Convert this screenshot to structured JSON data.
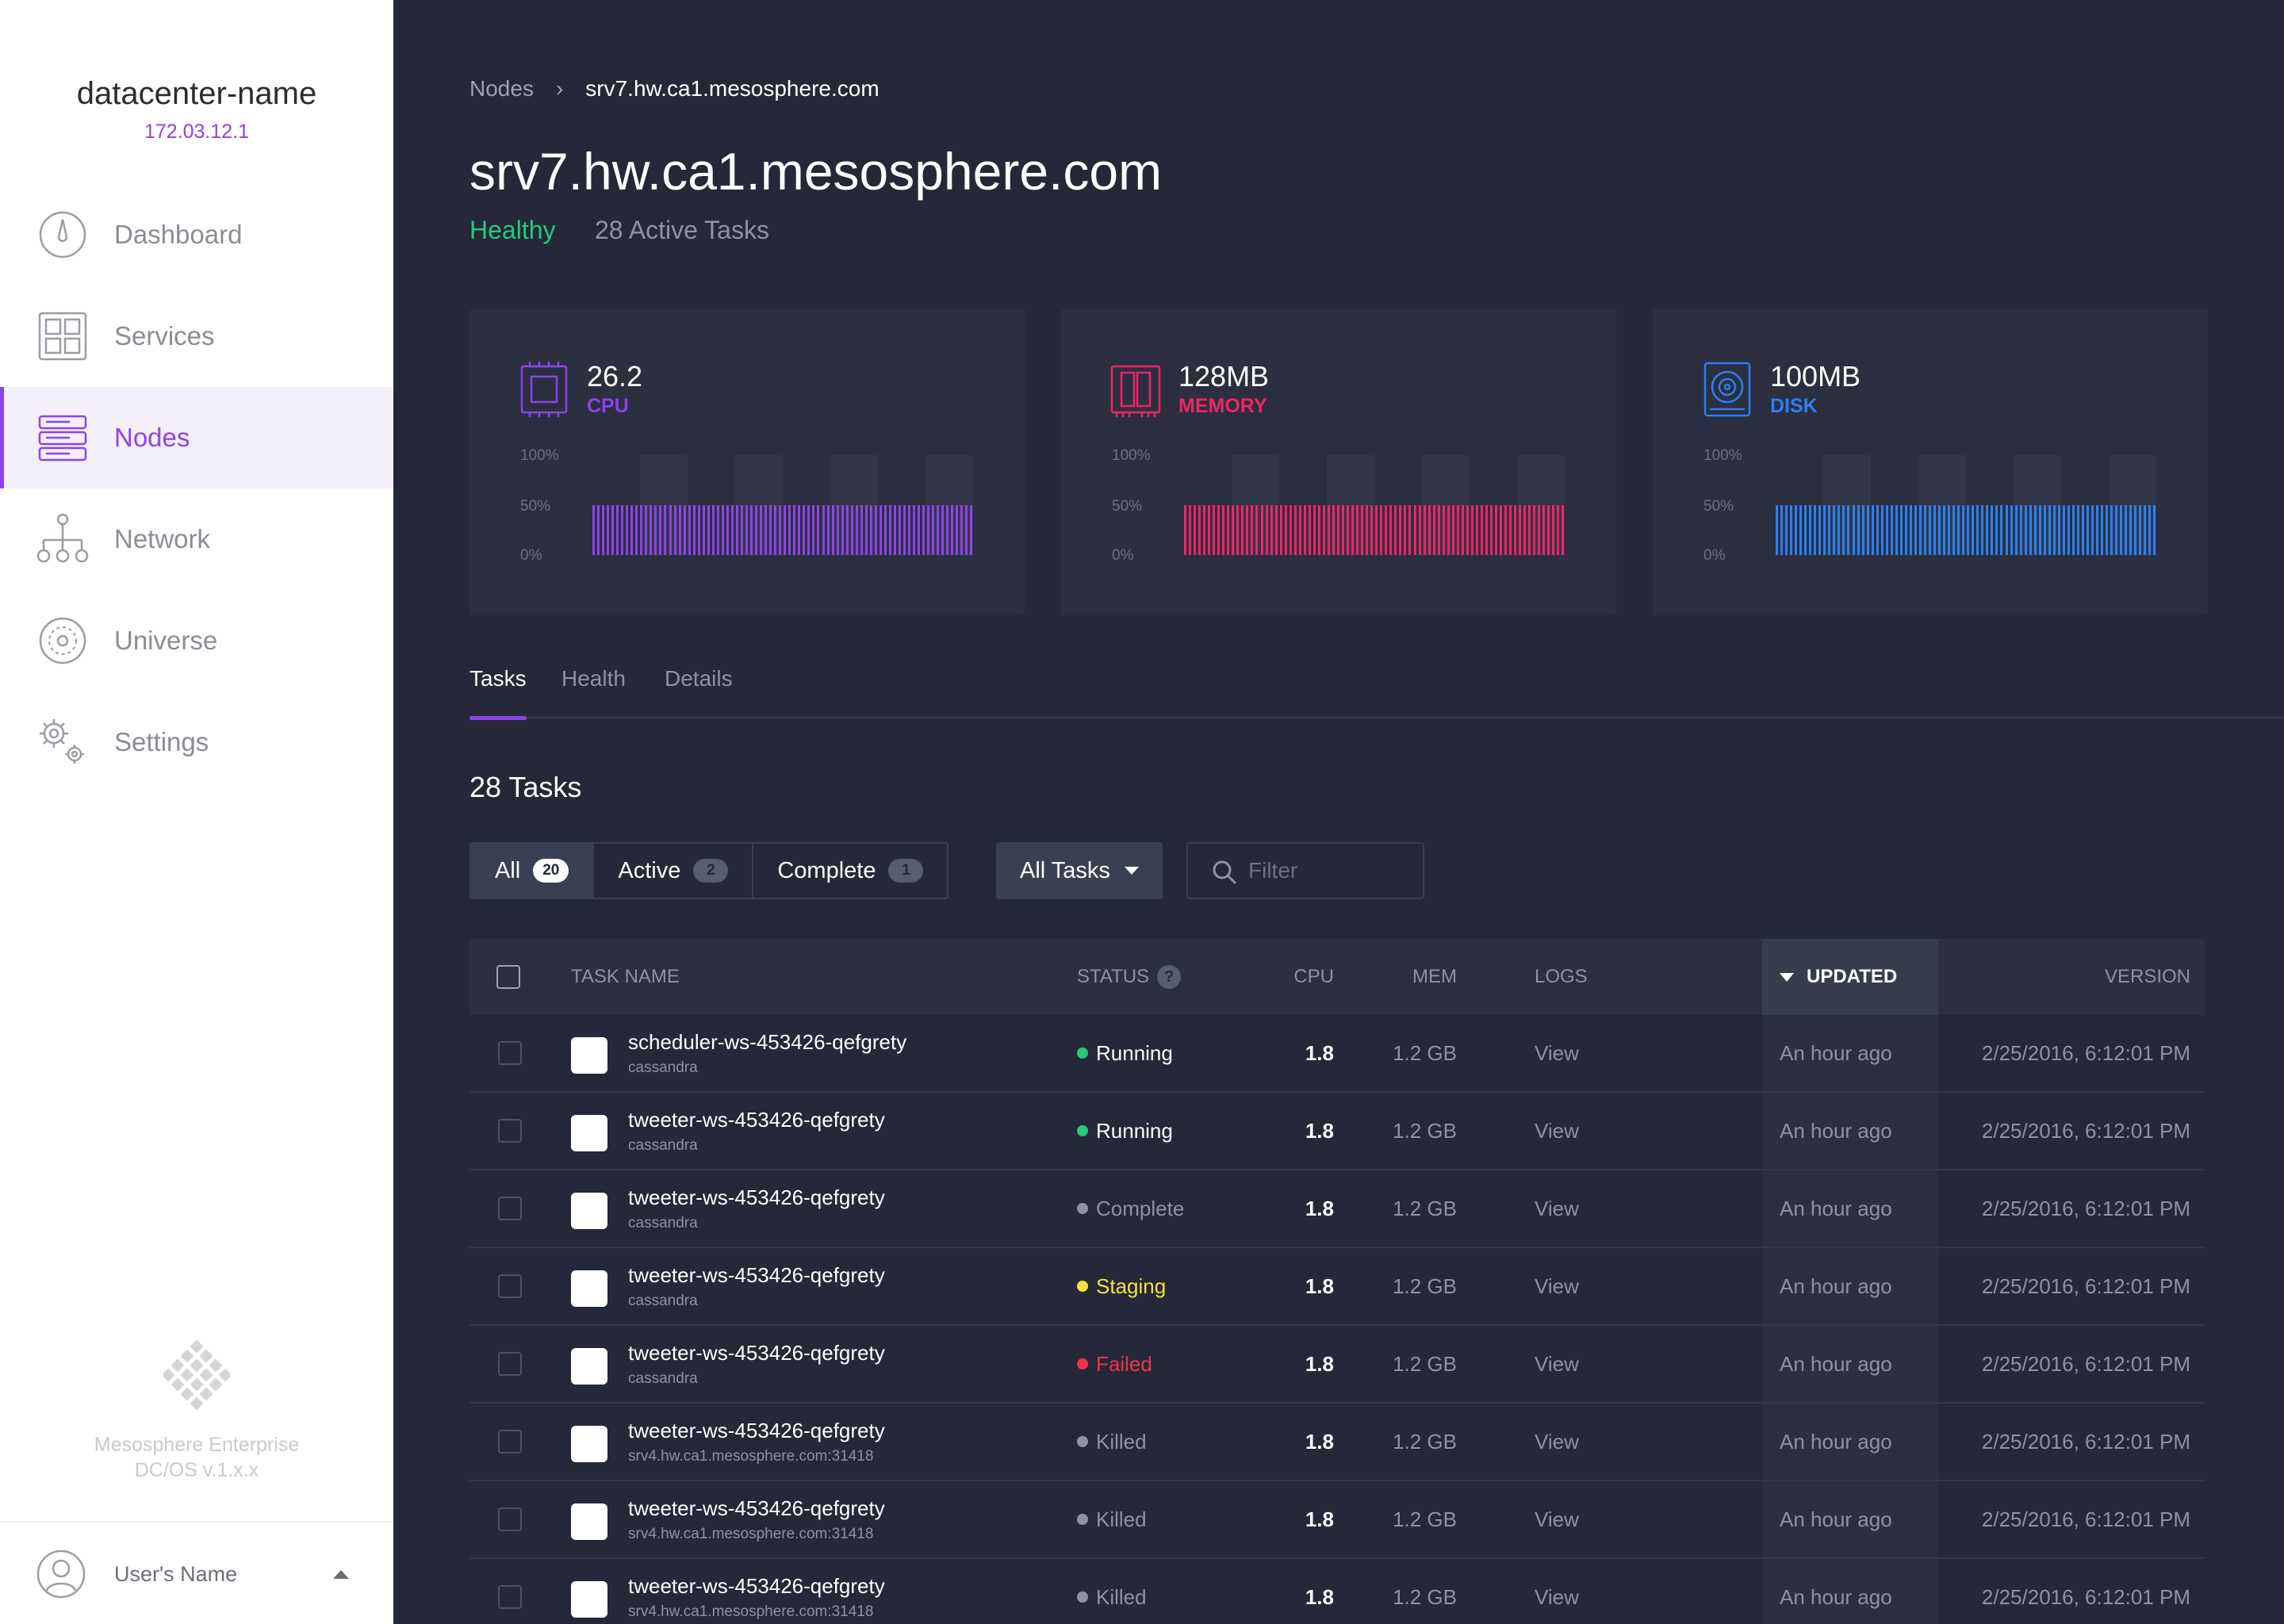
{
  "sidebar": {
    "datacenter_name": "datacenter-name",
    "datacenter_ip": "172.03.12.1",
    "items": [
      {
        "label": "Dashboard",
        "icon": "dashboard-icon"
      },
      {
        "label": "Services",
        "icon": "services-icon"
      },
      {
        "label": "Nodes",
        "icon": "nodes-icon",
        "active": true
      },
      {
        "label": "Network",
        "icon": "network-icon"
      },
      {
        "label": "Universe",
        "icon": "universe-icon"
      },
      {
        "label": "Settings",
        "icon": "settings-icon"
      }
    ],
    "brand": {
      "line1": "Mesosphere Enterprise",
      "line2": "DC/OS v.1.x.x"
    },
    "user": {
      "name": "User's Name"
    }
  },
  "breadcrumb": {
    "root": "Nodes",
    "separator": "›",
    "current": "srv7.hw.ca1.mesosphere.com"
  },
  "page": {
    "title": "srv7.hw.ca1.mesosphere.com",
    "health": "Healthy",
    "active_tasks": "28 Active Tasks"
  },
  "metrics": [
    {
      "value": "26.2",
      "label": "CPU",
      "color": "#8c44e6",
      "usage_percent": 50,
      "axis": [
        "100%",
        "50%",
        "0%"
      ]
    },
    {
      "value": "128MB",
      "label": "MEMORY",
      "color": "#ee2563",
      "usage_percent": 50,
      "axis": [
        "100%",
        "50%",
        "0%"
      ]
    },
    {
      "value": "100MB",
      "label": "DISK",
      "color": "#2a80f0",
      "usage_percent": 50,
      "axis": [
        "100%",
        "50%",
        "0%"
      ]
    }
  ],
  "tabs": [
    {
      "label": "Tasks",
      "active": true
    },
    {
      "label": "Health"
    },
    {
      "label": "Details"
    }
  ],
  "tasks_heading": "28 Tasks",
  "filters": {
    "buttons": [
      {
        "label": "All",
        "count": "20",
        "active": true
      },
      {
        "label": "Active",
        "count": "2"
      },
      {
        "label": "Complete",
        "count": "1"
      }
    ],
    "dropdown": "All Tasks",
    "search_placeholder": "Filter"
  },
  "table": {
    "headers": {
      "name": "TASK NAME",
      "status": "STATUS",
      "status_help": "?",
      "cpu": "CPU",
      "mem": "MEM",
      "logs": "LOGS",
      "updated": "UPDATED",
      "version": "VERSION"
    },
    "status_colors": {
      "Running": "#27c97a",
      "Complete": "#8f92a0",
      "Staging": "#f5e13d",
      "Failed": "#f0334b",
      "Killed": "#8f92a0"
    },
    "status_text_colors": {
      "Running": "#ffffff",
      "Complete": "#8f92a0",
      "Staging": "#f5e13d",
      "Failed": "#f0334b",
      "Killed": "#8f92a0"
    },
    "rows": [
      {
        "name": "scheduler-ws-453426-qefgrety",
        "host": "cassandra",
        "status": "Running",
        "cpu": "1.8",
        "mem": "1.2 GB",
        "logs": "View",
        "updated": "An hour ago",
        "version": "2/25/2016, 6:12:01 PM"
      },
      {
        "name": "tweeter-ws-453426-qefgrety",
        "host": "cassandra",
        "status": "Running",
        "cpu": "1.8",
        "mem": "1.2 GB",
        "logs": "View",
        "updated": "An hour ago",
        "version": "2/25/2016, 6:12:01 PM"
      },
      {
        "name": "tweeter-ws-453426-qefgrety",
        "host": "cassandra",
        "status": "Complete",
        "cpu": "1.8",
        "mem": "1.2 GB",
        "logs": "View",
        "updated": "An hour ago",
        "version": "2/25/2016, 6:12:01 PM"
      },
      {
        "name": "tweeter-ws-453426-qefgrety",
        "host": "cassandra",
        "status": "Staging",
        "cpu": "1.8",
        "mem": "1.2 GB",
        "logs": "View",
        "updated": "An hour ago",
        "version": "2/25/2016, 6:12:01 PM"
      },
      {
        "name": "tweeter-ws-453426-qefgrety",
        "host": "cassandra",
        "status": "Failed",
        "cpu": "1.8",
        "mem": "1.2 GB",
        "logs": "View",
        "updated": "An hour ago",
        "version": "2/25/2016, 6:12:01 PM"
      },
      {
        "name": "tweeter-ws-453426-qefgrety",
        "host": "srv4.hw.ca1.mesosphere.com:31418",
        "status": "Killed",
        "cpu": "1.8",
        "mem": "1.2 GB",
        "logs": "View",
        "updated": "An hour ago",
        "version": "2/25/2016, 6:12:01 PM"
      },
      {
        "name": "tweeter-ws-453426-qefgrety",
        "host": "srv4.hw.ca1.mesosphere.com:31418",
        "status": "Killed",
        "cpu": "1.8",
        "mem": "1.2 GB",
        "logs": "View",
        "updated": "An hour ago",
        "version": "2/25/2016, 6:12:01 PM"
      },
      {
        "name": "tweeter-ws-453426-qefgrety",
        "host": "srv4.hw.ca1.mesosphere.com:31418",
        "status": "Killed",
        "cpu": "1.8",
        "mem": "1.2 GB",
        "logs": "View",
        "updated": "An hour ago",
        "version": "2/25/2016, 6:12:01 PM"
      }
    ]
  }
}
